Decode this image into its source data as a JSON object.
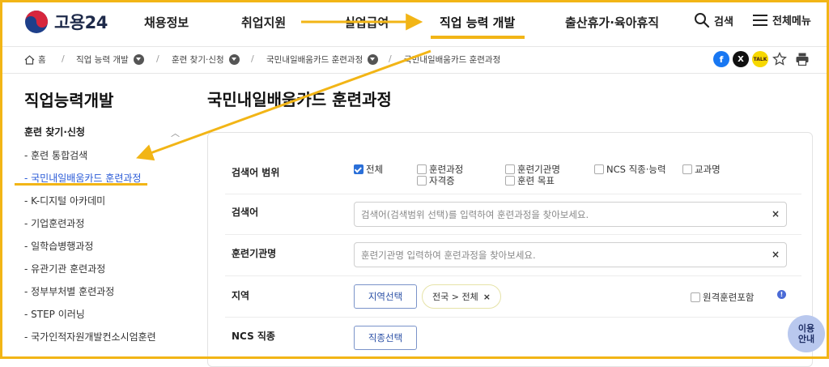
{
  "header": {
    "logo_text": "고용24",
    "nav": [
      "채용정보",
      "취업지원",
      "실업급여",
      "직업 능력 개발",
      "출산휴가·육아휴직"
    ],
    "search_label": "검색",
    "menu_label": "전체메뉴"
  },
  "breadcrumb": {
    "home": "홈",
    "items": [
      "직업 능력 개발",
      "훈련 찾기·신청",
      "국민내일배움카드 훈련과정",
      "국민내일배움카드 훈련과정"
    ]
  },
  "share": {
    "facebook_glyph": "f",
    "x_glyph": "X",
    "talk_glyph": "TALK"
  },
  "sidebar": {
    "title": "직업능력개발",
    "section": "훈련 찾기·신청",
    "items": [
      "- 훈련 통합검색",
      "- 국민내일배움카드 훈련과정",
      "- K-디지털 아카데미",
      "- 기업훈련과정",
      "- 일학습병행과정",
      "- 유관기관 훈련과정",
      "- 정부부처별 훈련과정",
      "- STEP 이러닝",
      "- 국가인적자원개발컨소시엄훈련"
    ]
  },
  "main": {
    "title": "국민내일배움카드 훈련과정",
    "scope_label": "검색어 범위",
    "scope_options": [
      "전체",
      "훈련과정",
      "훈련기관명",
      "NCS 직종·능력",
      "교과명",
      "자격증",
      "훈련 목표"
    ],
    "keyword_label": "검색어",
    "keyword_placeholder": "검색어(검색범위 선택)를 입력하여 훈련과정을 찾아보세요.",
    "institution_label": "훈련기관명",
    "institution_placeholder": "훈련기관명 입력하여 훈련과정을 찾아보세요.",
    "region_label": "지역",
    "region_button": "지역선택",
    "region_chip": "전국 > 전체",
    "remote_label": "원격훈련포함",
    "ncs_label": "NCS 직종",
    "ncs_button": "직종선택",
    "clear_glyph": "×",
    "info_glyph": "!"
  },
  "help": {
    "line1": "이용",
    "line2": "안내"
  },
  "colors": {
    "accent": "#f2b516",
    "link": "#2a5bd7",
    "checkbox_on": "#2a6fd8"
  }
}
